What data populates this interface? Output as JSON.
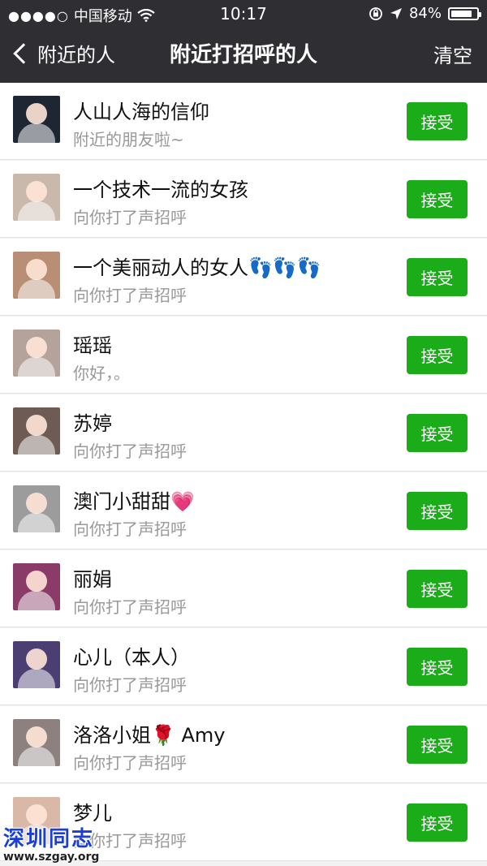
{
  "status_bar": {
    "signal_dots": "●●●●○",
    "carrier": "中国移动",
    "wifi_icon": "wifi-icon",
    "time": "10:17",
    "battery_percent": "84%",
    "battery_level": 0.84
  },
  "nav": {
    "back_label": "附近的人",
    "title": "附近打招呼的人",
    "clear_label": "清空"
  },
  "accept_label": "接受",
  "requests": [
    {
      "name": "人山人海的信仰",
      "message": "附近的朋友啦~",
      "avatar_color": "#1e2533"
    },
    {
      "name": "一个技术一流的女孩",
      "message": "向你打了声招呼",
      "avatar_color": "#c9b8ac"
    },
    {
      "name": "一个美丽动人的女人👣👣👣",
      "message": "向你打了声招呼",
      "avatar_color": "#b88e74"
    },
    {
      "name": "瑶瑶",
      "message": "你好，。",
      "avatar_color": "#b4a39b"
    },
    {
      "name": "苏婷",
      "message": "向你打了声招呼",
      "avatar_color": "#6e5c54"
    },
    {
      "name": "澳门小甜甜💗",
      "message": "向你打了声招呼",
      "avatar_color": "#9c9c9c"
    },
    {
      "name": "丽娟",
      "message": "向你打了声招呼",
      "avatar_color": "#8a3b68"
    },
    {
      "name": "心儿（本人）",
      "message": "向你打了声招呼",
      "avatar_color": "#4a3e72"
    },
    {
      "name": "洛洛小姐🌹 Amy",
      "message": "向你打了声招呼",
      "avatar_color": "#8d8180"
    },
    {
      "name": "梦儿",
      "message": "向你打了声招呼",
      "avatar_color": "#d9b8a8"
    }
  ],
  "watermark": {
    "title": "深圳同志",
    "url": "www.szgay.org"
  }
}
